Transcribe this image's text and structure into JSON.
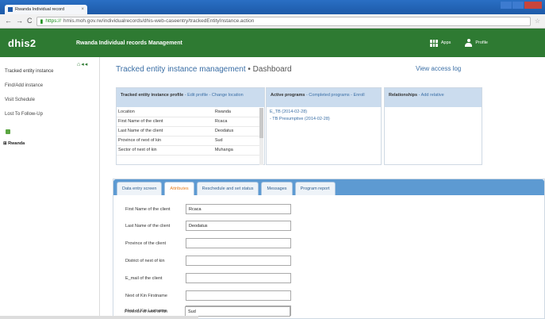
{
  "browser": {
    "tab_title": "Rwanda Individual record",
    "tab_close": "×",
    "url_https": "https://",
    "url_rest": "hmis.moh.gov.rw/individualrecords/dhis-web-caseentry/trackedEntityInstance.action"
  },
  "header": {
    "logo": "dhis2",
    "title": "Rwanda Individual records Management",
    "apps_label": "Apps",
    "profile_label": "Profile"
  },
  "sidebar": {
    "items": [
      {
        "label": "Tracked entity instance"
      },
      {
        "label": "Find/Add instance"
      },
      {
        "label": "Visit Schedule"
      },
      {
        "label": "Lost To Follow-Up"
      }
    ],
    "tree_root": "⊞ Rwanda"
  },
  "main": {
    "title": "Tracked entity instance management",
    "subtitle": "• Dashboard",
    "view_access": "View access log"
  },
  "profile_panel": {
    "head": "Tracked entity instance profile",
    "links": "- Edit profile - Change location",
    "rows": [
      {
        "k": "Location",
        "v": "Rwanda"
      },
      {
        "k": "First Name of the client",
        "v": "Rcaca"
      },
      {
        "k": "Last Name of the client",
        "v": "Deodatus"
      },
      {
        "k": "Province of next of kin",
        "v": "Sud"
      },
      {
        "k": "Sector of next of kin",
        "v": "Muhanga"
      }
    ]
  },
  "programs_panel": {
    "head": "Active programs",
    "links": "- Completed programs - Enroll",
    "items": [
      "E_TB (2014-02-28)",
      "- TB Presumptive (2014-02-28)"
    ]
  },
  "relationships_panel": {
    "head": "Relationships",
    "links": "- Add relative"
  },
  "tabs": [
    {
      "label": "Data entry screen"
    },
    {
      "label": "Attributes"
    },
    {
      "label": "Reschedule and set status"
    },
    {
      "label": "Messages"
    },
    {
      "label": "Program report"
    }
  ],
  "form": [
    {
      "label": "First Name of the client",
      "value": "Rcaca"
    },
    {
      "label": "Last Name of the client",
      "value": "Deodatus"
    },
    {
      "label": "Province of the client",
      "value": ""
    },
    {
      "label": "District of next of kin",
      "value": ""
    },
    {
      "label": "E_mail of the client",
      "value": ""
    },
    {
      "label": "Next of Kin Firstname",
      "value": ""
    },
    {
      "label": "Next of Kin Lastname",
      "value": ""
    },
    {
      "label": "Province of next of kin",
      "value": "Sud"
    }
  ]
}
